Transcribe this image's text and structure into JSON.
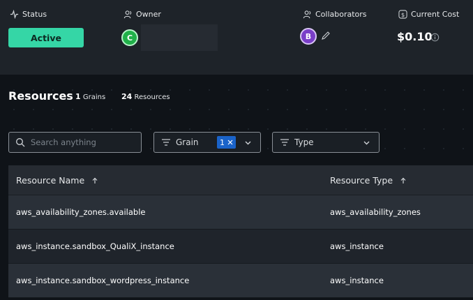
{
  "header": {
    "status": {
      "label": "Status",
      "value": "Active"
    },
    "owner": {
      "label": "Owner",
      "avatar_initial": "C"
    },
    "collaborators": {
      "label": "Collaborators",
      "avatar_initial": "B"
    },
    "cost": {
      "label": "Current Cost",
      "value": "$0.10"
    }
  },
  "resources": {
    "title": "Resources",
    "grains_count": "1",
    "grains_label": "Grains",
    "resources_count": "24",
    "resources_label": "Resources"
  },
  "filters": {
    "search_placeholder": "Search anything",
    "grain": {
      "label": "Grain",
      "badge_count": "1"
    },
    "type": {
      "label": "Type"
    }
  },
  "table": {
    "columns": [
      "Resource Name",
      "Resource Type"
    ],
    "rows": [
      {
        "name": "aws_availability_zones.available",
        "type": "aws_availability_zones"
      },
      {
        "name": "aws_instance.sandbox_QualiX_instance",
        "type": "aws_instance"
      },
      {
        "name": "aws_instance.sandbox_wordpress_instance",
        "type": "aws_instance"
      }
    ]
  },
  "colors": {
    "status_active": "#35d6a6",
    "owner_avatar": "#21b14a",
    "collaborator_avatar": "#7a3ec8",
    "filter_badge": "#1a63c9"
  }
}
